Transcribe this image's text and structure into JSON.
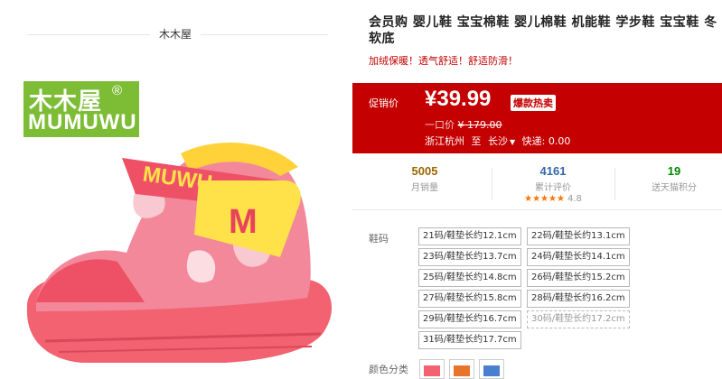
{
  "brand": {
    "name": "木木屋",
    "logo_cn": "木木屋",
    "logo_reg": "®",
    "logo_en": "MUMUWU",
    "shoe_strap_letter": "M",
    "shoe_side_text": "MUWU"
  },
  "product": {
    "title": "会员购 婴儿鞋 宝宝棉鞋 婴儿棉鞋 机能鞋 学步鞋 宝宝鞋 冬 软底",
    "subtitle": "加绒保暖！透气舒适！舒适防滑！"
  },
  "promo": {
    "label": "促销价",
    "price": "¥39.99",
    "badge": "爆款热卖",
    "orig_label": "一口价",
    "orig_price": "¥ 179.00",
    "ship_from": "浙江杭州",
    "ship_to_word": "至",
    "ship_to": "长沙",
    "express": "快递: 0.00"
  },
  "stats": [
    {
      "num": "5005",
      "label": "月销量",
      "color": "#996600"
    },
    {
      "num": "4161",
      "label": "累计评价",
      "color": "#3366aa",
      "stars": "★★★★★",
      "score": "4.8"
    },
    {
      "num": "19",
      "label": "送天猫积分",
      "color": "#008800"
    }
  ],
  "sku": {
    "label": "鞋码",
    "sizes": [
      "21码/鞋垫长约12.1cm",
      "22码/鞋垫长约13.1cm",
      "23码/鞋垫长约13.7cm",
      "24码/鞋垫长约14.1cm",
      "25码/鞋垫长约14.8cm",
      "26码/鞋垫长约15.2cm",
      "27码/鞋垫长约15.8cm",
      "28码/鞋垫长约16.2cm",
      "29码/鞋垫长约16.7cm",
      "30码/鞋垫长约17.2cm",
      "31码/鞋垫长约17.7cm"
    ],
    "color_label": "颜色分类"
  },
  "colors": {
    "brand_green": "#7dbd36",
    "promo_red": "#c40000",
    "star_orange": "#fe7200"
  }
}
